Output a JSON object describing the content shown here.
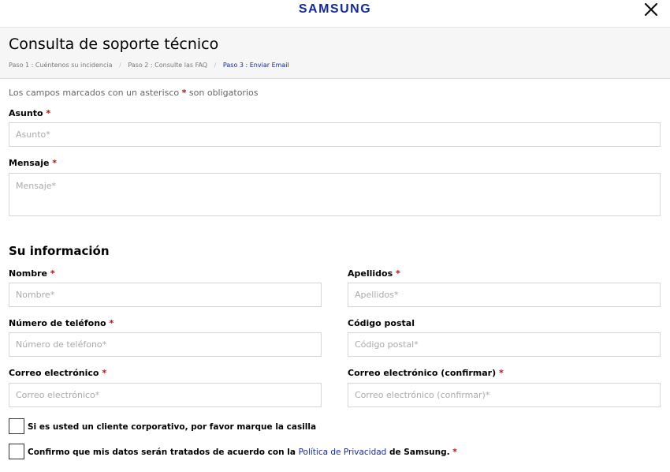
{
  "brand": {
    "logo_text": "SAMSUNG",
    "color": "#1428a0"
  },
  "header": {
    "title": "Consulta de soporte técnico",
    "steps": [
      {
        "label": "Paso 1 : Cuéntenos su incidencia",
        "active": false
      },
      {
        "label": "Paso 2 : Consulte las FAQ",
        "active": false
      },
      {
        "label": "Paso 3 : Enviar Email",
        "active": true
      }
    ],
    "step_separator": "/"
  },
  "form": {
    "required_note_before": "Los campos marcados con un asterisco",
    "required_note_after": "son obligatorios",
    "required_mark": "*",
    "subject": {
      "label": "Asunto",
      "placeholder": "Asunto*",
      "value": ""
    },
    "message": {
      "label": "Mensaje",
      "placeholder": "Mensaje*",
      "value": ""
    },
    "info_section_title": "Su información",
    "first_name": {
      "label": "Nombre",
      "placeholder": "Nombre*",
      "value": ""
    },
    "last_name": {
      "label": "Apellidos",
      "placeholder": "Apellidos*",
      "value": ""
    },
    "phone": {
      "label": "Número de teléfono",
      "placeholder": "Número de teléfono*",
      "value": ""
    },
    "postal_code": {
      "label": "Código postal",
      "placeholder": "Código postal*",
      "value": ""
    },
    "email": {
      "label": "Correo electrónico",
      "placeholder": "Correo electrónico*",
      "value": ""
    },
    "email_confirm": {
      "label": "Correo electrónico (confirmar)",
      "placeholder": "Correo electrónico (confirmar)*",
      "value": ""
    },
    "corporate_checkbox": {
      "label": "Si es usted un cliente corporativo, por favor marque la casilla",
      "checked": false
    },
    "privacy_checkbox": {
      "label_before": "Confirmo que mis datos serán tratados de acuerdo con la",
      "link_text": "Política de Privacidad",
      "label_after": "de Samsung.",
      "checked": false
    }
  },
  "icons": {
    "close": "close-icon"
  },
  "colors": {
    "required": "#dd0000",
    "link": "#1428a0",
    "header_bg": "#f6f6f6"
  }
}
